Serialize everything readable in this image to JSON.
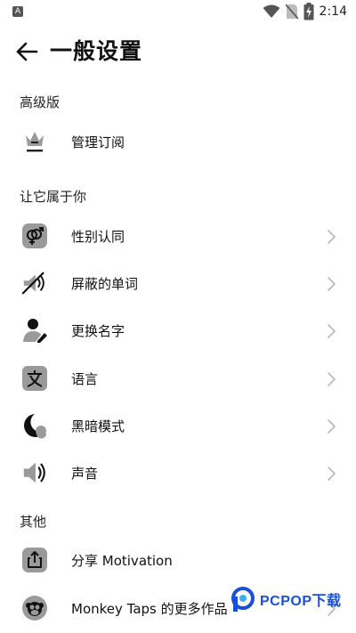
{
  "status_bar": {
    "app_badge": "A",
    "time": "2:14",
    "icons": [
      "wifi-icon",
      "no-sim-icon",
      "battery-charging-icon"
    ]
  },
  "header": {
    "title": "一般设置",
    "back_icon": "arrow-left-icon"
  },
  "sections": {
    "premium": {
      "title": "高级版",
      "items": [
        {
          "label": "管理订阅",
          "icon": "crown-icon"
        }
      ]
    },
    "personalize": {
      "title": "让它属于你",
      "items": [
        {
          "label": "性别认同",
          "icon": "gender-icon"
        },
        {
          "label": "屏蔽的单词",
          "icon": "muted-words-icon"
        },
        {
          "label": "更换名字",
          "icon": "edit-name-icon"
        },
        {
          "label": "语言",
          "icon": "language-icon"
        },
        {
          "label": "黑暗模式",
          "icon": "moon-icon"
        },
        {
          "label": "声音",
          "icon": "speaker-icon"
        }
      ]
    },
    "other": {
      "title": "其他",
      "items": [
        {
          "label": "分享 Motivation",
          "icon": "share-icon"
        },
        {
          "label": "Monkey Taps 的更多作品",
          "icon": "monkey-icon"
        }
      ]
    }
  },
  "watermark": {
    "text": "PCPOP下载"
  },
  "colors": {
    "background": "#ffffff",
    "text": "#111111",
    "icon_gray": "#9a9a9a",
    "chevron": "#b8b8b8",
    "watermark_blue": "#1a4fd8"
  }
}
